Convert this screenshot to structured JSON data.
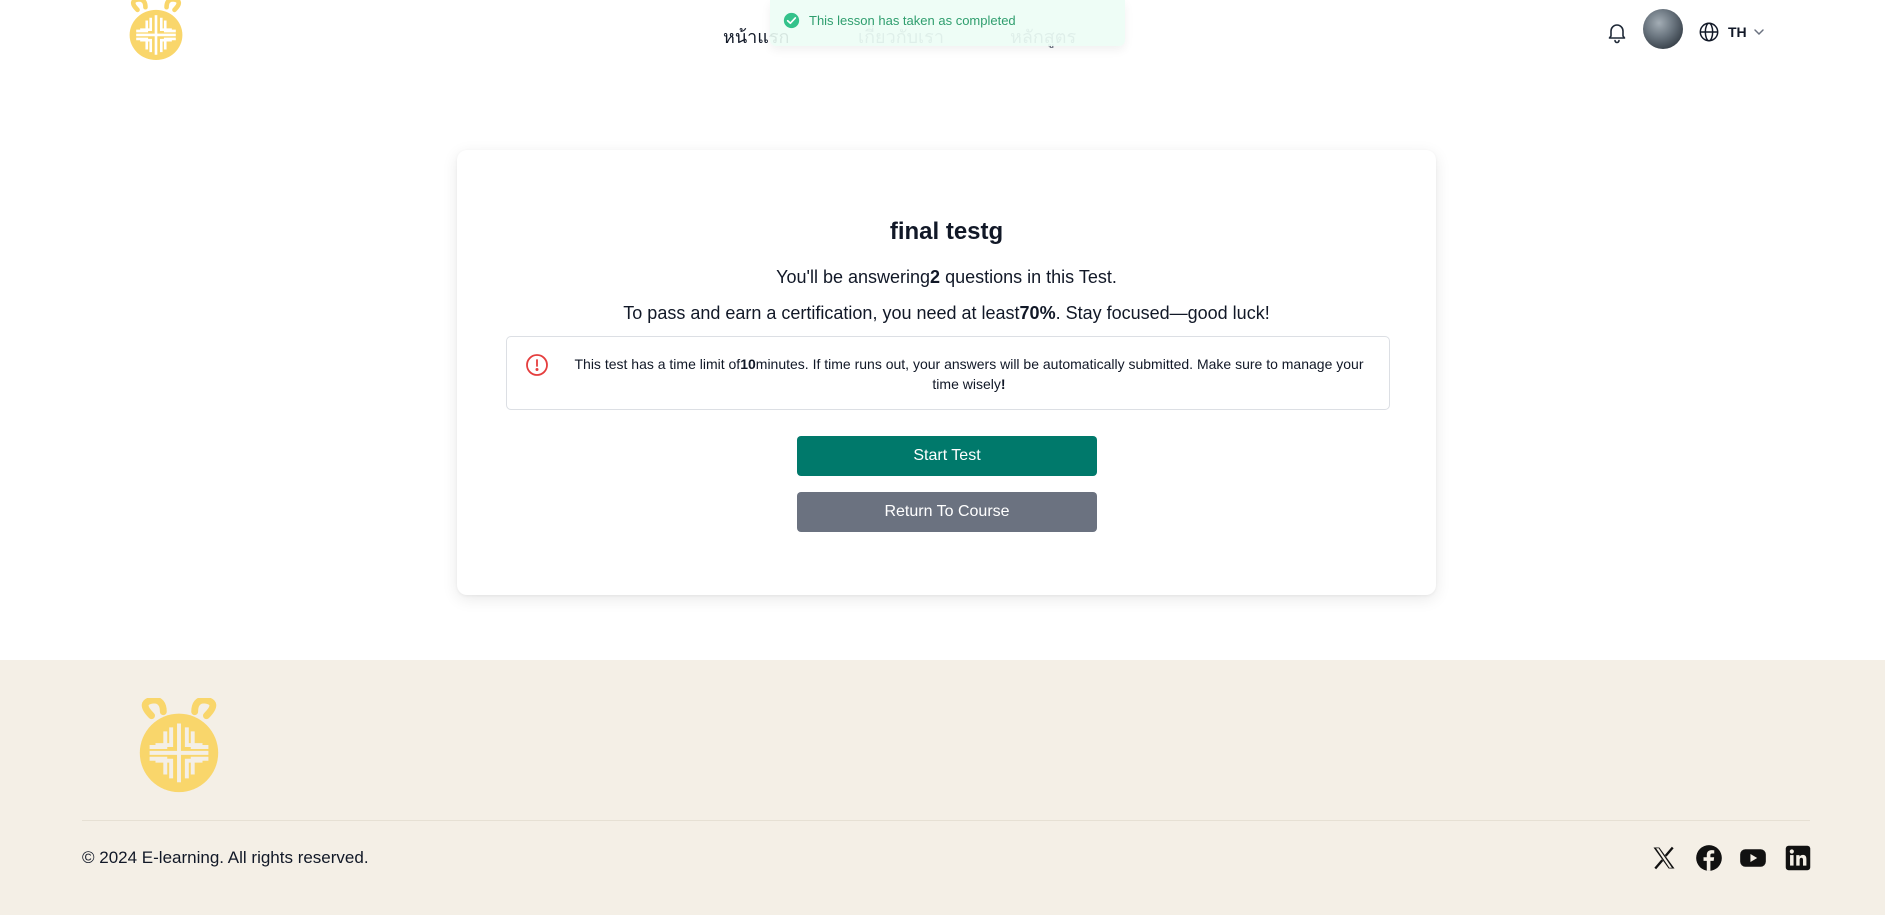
{
  "header": {
    "nav": [
      {
        "label": "หน้าแรก"
      },
      {
        "label": "เกี่ยวกับเรา"
      },
      {
        "label": "หลักสูตร"
      }
    ],
    "toast": {
      "text": "This lesson has taken as completed",
      "icon": "check-circle-icon"
    },
    "language": {
      "code": "TH"
    }
  },
  "test": {
    "title": "final testg",
    "answer_prefix": "You'll be answering",
    "question_count": "2",
    "answer_suffix": " questions in this Test.",
    "pass_prefix": "To pass and earn a certification, you need at least",
    "pass_percent": "70%",
    "pass_suffix": ". Stay focused—good luck!",
    "notice_prefix": "This test has a time limit of",
    "notice_minutes": "10",
    "notice_suffix": "minutes. If time runs out, your answers will be automatically submitted. Make sure to manage your time wisely",
    "notice_end": "!",
    "start_label": "Start Test",
    "return_label": "Return To Course"
  },
  "footer": {
    "copyright": "© 2024 E-learning. All rights reserved.",
    "social": [
      "x-icon",
      "facebook-icon",
      "youtube-icon",
      "linkedin-icon"
    ]
  },
  "colors": {
    "primary": "#00796b",
    "secondary": "#6b7280",
    "footer_bg": "#f4efe6",
    "logo": "#f9d66b",
    "alert": "#e53e3e",
    "success": "#2f9e6e"
  }
}
